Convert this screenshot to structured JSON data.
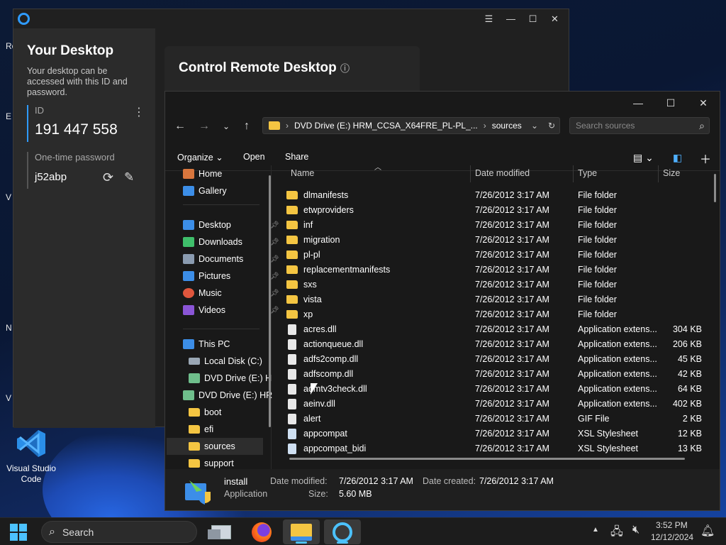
{
  "desktop": {
    "edge_letters": [
      "Ro",
      "E",
      "V",
      "N",
      "V"
    ],
    "vs_code_label": "Visual Studio Code"
  },
  "anydesk": {
    "title_icons": [
      "menu-icon",
      "minimize-icon",
      "maximize-icon",
      "close-icon"
    ],
    "your_desktop_title": "Your Desktop",
    "your_desktop_desc": "Your desktop can be accessed with this ID and password.",
    "id_label": "ID",
    "id_value": "191 447 558",
    "otp_label": "One-time password",
    "otp_value": "j52abp",
    "control_title": "Control Remote Desktop"
  },
  "explorer": {
    "address": {
      "drive": "DVD Drive (E:) HRM_CCSA_X64FRE_PL-PL_...",
      "folder": "sources"
    },
    "search_placeholder": "Search sources",
    "commands": {
      "organize": "Organize",
      "open": "Open",
      "share": "Share"
    },
    "nav": {
      "home": "Home",
      "gallery": "Gallery",
      "quick": [
        {
          "label": "Desktop",
          "color": "#3c8ee8"
        },
        {
          "label": "Downloads",
          "color": "#3fbf6b"
        },
        {
          "label": "Documents",
          "color": "#8a9bb0"
        },
        {
          "label": "Pictures",
          "color": "#3c8ee8"
        },
        {
          "label": "Music",
          "color": "#e0563d"
        },
        {
          "label": "Videos",
          "color": "#8a55d6"
        }
      ],
      "this_pc": "This PC",
      "local_disk": "Local Disk (C:)",
      "dvd_short": "DVD Drive (E:) H",
      "dvd_long": "DVD Drive (E:) HR",
      "folders": [
        "boot",
        "efi",
        "sources",
        "support"
      ]
    },
    "columns": {
      "name": "Name",
      "date": "Date modified",
      "type": "Type",
      "size": "Size"
    },
    "files": [
      {
        "name": "dlmanifests",
        "date": "7/26/2012 3:17 AM",
        "type": "File folder",
        "size": "",
        "icon": "folder"
      },
      {
        "name": "etwproviders",
        "date": "7/26/2012 3:17 AM",
        "type": "File folder",
        "size": "",
        "icon": "folder"
      },
      {
        "name": "inf",
        "date": "7/26/2012 3:17 AM",
        "type": "File folder",
        "size": "",
        "icon": "folder"
      },
      {
        "name": "migration",
        "date": "7/26/2012 3:17 AM",
        "type": "File folder",
        "size": "",
        "icon": "folder"
      },
      {
        "name": "pl-pl",
        "date": "7/26/2012 3:17 AM",
        "type": "File folder",
        "size": "",
        "icon": "folder"
      },
      {
        "name": "replacementmanifests",
        "date": "7/26/2012 3:17 AM",
        "type": "File folder",
        "size": "",
        "icon": "folder"
      },
      {
        "name": "sxs",
        "date": "7/26/2012 3:17 AM",
        "type": "File folder",
        "size": "",
        "icon": "folder"
      },
      {
        "name": "vista",
        "date": "7/26/2012 3:17 AM",
        "type": "File folder",
        "size": "",
        "icon": "folder"
      },
      {
        "name": "xp",
        "date": "7/26/2012 3:17 AM",
        "type": "File folder",
        "size": "",
        "icon": "folder"
      },
      {
        "name": "acres.dll",
        "date": "7/26/2012 3:17 AM",
        "type": "Application extens...",
        "size": "304 KB",
        "icon": "dll"
      },
      {
        "name": "actionqueue.dll",
        "date": "7/26/2012 3:17 AM",
        "type": "Application extens...",
        "size": "206 KB",
        "icon": "dll"
      },
      {
        "name": "adfs2comp.dll",
        "date": "7/26/2012 3:17 AM",
        "type": "Application extens...",
        "size": "45 KB",
        "icon": "dll"
      },
      {
        "name": "adfscomp.dll",
        "date": "7/26/2012 3:17 AM",
        "type": "Application extens...",
        "size": "42 KB",
        "icon": "dll"
      },
      {
        "name": "admtv3check.dll",
        "date": "7/26/2012 3:17 AM",
        "type": "Application extens...",
        "size": "64 KB",
        "icon": "dll"
      },
      {
        "name": "aeinv.dll",
        "date": "7/26/2012 3:17 AM",
        "type": "Application extens...",
        "size": "402 KB",
        "icon": "dll"
      },
      {
        "name": "alert",
        "date": "7/26/2012 3:17 AM",
        "type": "GIF File",
        "size": "2 KB",
        "icon": "gif"
      },
      {
        "name": "appcompat",
        "date": "7/26/2012 3:17 AM",
        "type": "XSL Stylesheet",
        "size": "12 KB",
        "icon": "xsl"
      },
      {
        "name": "appcompat_bidi",
        "date": "7/26/2012 3:17 AM",
        "type": "XSL Stylesheet",
        "size": "13 KB",
        "icon": "xsl"
      }
    ],
    "details": {
      "name": "install",
      "kind": "Application",
      "modified_label": "Date modified:",
      "modified_value": "7/26/2012 3:17 AM",
      "size_label": "Size:",
      "size_value": "5.60 MB",
      "created_label": "Date created:",
      "created_value": "7/26/2012 3:17 AM"
    }
  },
  "taskbar": {
    "search_label": "Search",
    "time": "3:52 PM",
    "date": "12/12/2024"
  }
}
